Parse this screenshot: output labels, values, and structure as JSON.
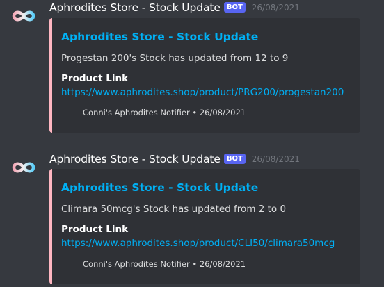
{
  "colors": {
    "background": "#36393f",
    "embed_background": "#2f3136",
    "embed_border": "#ffb6c1",
    "link": "#00b0f4",
    "bot_tag": "#5865f2",
    "timestamp": "#72767d"
  },
  "messages": [
    {
      "avatar_icon": "infinity-icon",
      "username": "Aphrodites Store - Stock Update",
      "bot_tag": "BOT",
      "timestamp": "26/08/2021",
      "embed": {
        "title": "Aphrodites Store - Stock Update",
        "description": "Progestan 200's Stock has updated from 12 to 9",
        "field_name": "Product Link",
        "field_value": "https://www.aphrodites.shop/product/PRG200/progestan200",
        "footer": "Conni's Aphrodites Notifier • 26/08/2021"
      }
    },
    {
      "avatar_icon": "infinity-icon",
      "username": "Aphrodites Store - Stock Update",
      "bot_tag": "BOT",
      "timestamp": "26/08/2021",
      "embed": {
        "title": "Aphrodites Store - Stock Update",
        "description": "Climara 50mcg's Stock has updated from 2 to 0",
        "field_name": "Product Link",
        "field_value": "https://www.aphrodites.shop/product/CLI50/climara50mcg",
        "footer": "Conni's Aphrodites Notifier • 26/08/2021"
      }
    }
  ]
}
